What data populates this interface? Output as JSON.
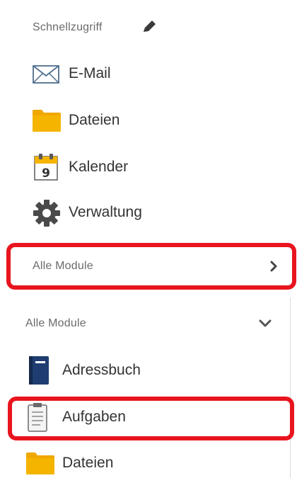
{
  "quick_access": {
    "title": "Schnellzugriff",
    "edit_icon": "pencil-icon",
    "items": [
      {
        "label": "E-Mail",
        "icon": "envelope-icon"
      },
      {
        "label": "Dateien",
        "icon": "folder-icon"
      },
      {
        "label": "Kalender",
        "icon": "calendar-icon",
        "calendar_day": "9"
      },
      {
        "label": "Verwaltung",
        "icon": "gear-icon"
      }
    ]
  },
  "collapsed_modules": {
    "label": "Alle Module",
    "icon": "chevron-right-icon"
  },
  "expanded_modules": {
    "label": "Alle Module",
    "icon": "chevron-down-icon",
    "items": [
      {
        "label": "Adressbuch",
        "icon": "address-book-icon"
      },
      {
        "label": "Aufgaben",
        "icon": "clipboard-icon"
      },
      {
        "label": "Dateien",
        "icon": "folder-icon"
      }
    ]
  },
  "colors": {
    "highlight": "#e8141e",
    "folder": "#f5b400",
    "address_book": "#1f3d70",
    "gear": "#4a4a4a"
  }
}
